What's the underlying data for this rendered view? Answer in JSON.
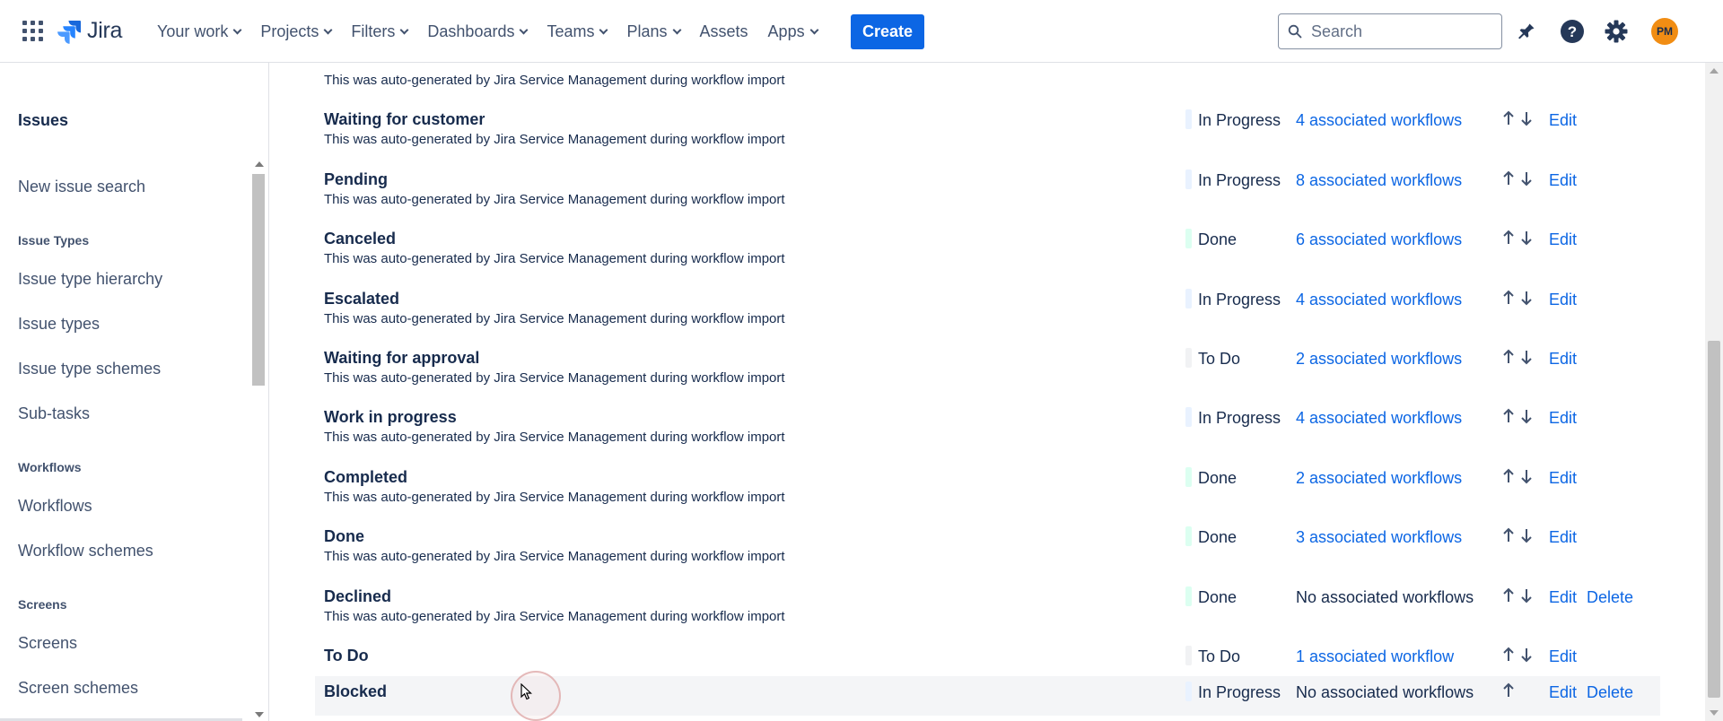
{
  "nav": {
    "logo": "Jira",
    "items": [
      "Your work",
      "Projects",
      "Filters",
      "Dashboards",
      "Teams",
      "Plans",
      "Assets",
      "Apps"
    ],
    "item_has_dropdown": [
      true,
      true,
      true,
      true,
      true,
      true,
      false,
      true
    ],
    "create_label": "Create",
    "search_placeholder": "Search",
    "avatar_initials": "PM",
    "icons": [
      "app-switcher-icon",
      "notifications-icon",
      "help-icon",
      "settings-icon"
    ]
  },
  "sidebar": {
    "heading": "Issues",
    "new_issue_search": "New issue search",
    "section_issue_types": "Issue Types",
    "issue_type_hierarchy": "Issue type hierarchy",
    "issue_types": "Issue types",
    "issue_type_schemes": "Issue type schemes",
    "sub_tasks": "Sub-tasks",
    "section_workflows": "Workflows",
    "workflows": "Workflows",
    "workflow_schemes": "Workflow schemes",
    "section_screens": "Screens",
    "screens": "Screens",
    "screen_schemes": "Screen schemes"
  },
  "colors": {
    "in_progress": "#e9f2ff",
    "done": "#dcfff1",
    "todo": "#f1f2f4",
    "link": "#0c66e4",
    "create_button": "#0c66e4",
    "avatar": "#f18d13"
  },
  "statuses": {
    "partial_row": {
      "description": "This was auto-generated by Jira Service Management during workflow import"
    },
    "rows": [
      {
        "name": "Waiting for customer",
        "description": "This was auto-generated by Jira Service Management during workflow import",
        "category": "In Progress",
        "category_key": "in_progress",
        "workflows": "4 associated workflows",
        "linked": true,
        "up": true,
        "down": true,
        "edit": "Edit",
        "delete": ""
      },
      {
        "name": "Pending",
        "description": "This was auto-generated by Jira Service Management during workflow import",
        "category": "In Progress",
        "category_key": "in_progress",
        "workflows": "8 associated workflows",
        "linked": true,
        "up": true,
        "down": true,
        "edit": "Edit",
        "delete": ""
      },
      {
        "name": "Canceled",
        "description": "This was auto-generated by Jira Service Management during workflow import",
        "category": "Done",
        "category_key": "done",
        "workflows": "6 associated workflows",
        "linked": true,
        "up": true,
        "down": true,
        "edit": "Edit",
        "delete": ""
      },
      {
        "name": "Escalated",
        "description": "This was auto-generated by Jira Service Management during workflow import",
        "category": "In Progress",
        "category_key": "in_progress",
        "workflows": "4 associated workflows",
        "linked": true,
        "up": true,
        "down": true,
        "edit": "Edit",
        "delete": ""
      },
      {
        "name": "Waiting for approval",
        "description": "This was auto-generated by Jira Service Management during workflow import",
        "category": "To Do",
        "category_key": "todo",
        "workflows": "2 associated workflows",
        "linked": true,
        "up": true,
        "down": true,
        "edit": "Edit",
        "delete": ""
      },
      {
        "name": "Work in progress",
        "description": "This was auto-generated by Jira Service Management during workflow import",
        "category": "In Progress",
        "category_key": "in_progress",
        "workflows": "4 associated workflows",
        "linked": true,
        "up": true,
        "down": true,
        "edit": "Edit",
        "delete": ""
      },
      {
        "name": "Completed",
        "description": "This was auto-generated by Jira Service Management during workflow import",
        "category": "Done",
        "category_key": "done",
        "workflows": "2 associated workflows",
        "linked": true,
        "up": true,
        "down": true,
        "edit": "Edit",
        "delete": ""
      },
      {
        "name": "Done",
        "description": "This was auto-generated by Jira Service Management during workflow import",
        "category": "Done",
        "category_key": "done",
        "workflows": "3 associated workflows",
        "linked": true,
        "up": true,
        "down": true,
        "edit": "Edit",
        "delete": ""
      },
      {
        "name": "Declined",
        "description": "This was auto-generated by Jira Service Management during workflow import",
        "category": "Done",
        "category_key": "done",
        "workflows": "No associated workflows",
        "linked": false,
        "up": true,
        "down": true,
        "edit": "Edit",
        "delete": "Delete"
      },
      {
        "name": "To Do",
        "description": "",
        "category": "To Do",
        "category_key": "todo",
        "workflows": "1 associated workflow",
        "linked": true,
        "up": true,
        "down": true,
        "edit": "Edit",
        "delete": ""
      },
      {
        "name": "Blocked",
        "description": "",
        "category": "In Progress",
        "category_key": "in_progress",
        "workflows": "No associated workflows",
        "linked": false,
        "up": true,
        "down": false,
        "edit": "Edit",
        "delete": "Delete",
        "highlighted": true
      }
    ]
  }
}
